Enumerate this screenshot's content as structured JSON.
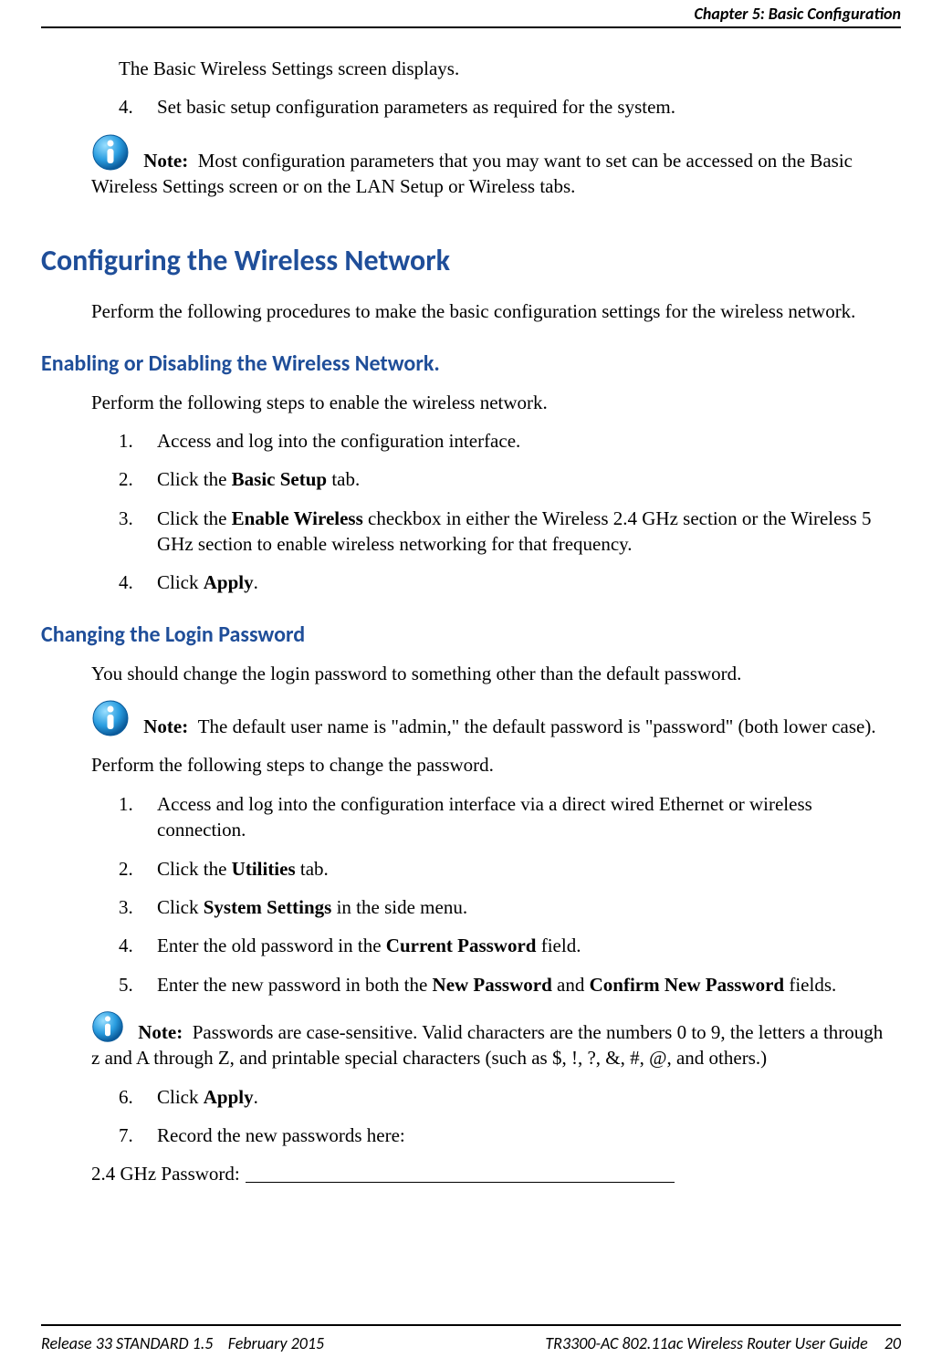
{
  "header": {
    "chapter": "Chapter 5",
    "separator": ":",
    "title": "Basic Configuration"
  },
  "intro": {
    "p1": "The Basic Wireless Settings screen displays.",
    "step4_num": "4.",
    "step4": "Set basic setup configuration parameters as required for the system.",
    "note_label": "Note:",
    "note_text": "Most configuration parameters that you may want to set can be accessed on the Basic Wireless Settings screen or on the LAN Setup or Wireless tabs."
  },
  "section1": {
    "heading": "Configuring the Wireless Network",
    "p1": "Perform the following procedures to make the basic configuration settings for the wireless network."
  },
  "enabling": {
    "heading": "Enabling or Disabling the Wireless Network.",
    "p1": "Perform the following steps to enable the wireless network.",
    "s1_num": "1.",
    "s1": "Access and log into the configuration interface.",
    "s2_num": "2.",
    "s2_a": "Click the ",
    "s2_b": "Basic Setup",
    "s2_c": " tab.",
    "s3_num": "3.",
    "s3_a": "Click the ",
    "s3_b": "Enable Wireless",
    "s3_c": " checkbox in either the Wireless 2.4 GHz section or the Wireless 5 GHz section to enable wireless networking for that frequency.",
    "s4_num": "4.",
    "s4_a": "Click ",
    "s4_b": "Apply",
    "s4_c": "."
  },
  "changing": {
    "heading": "Changing the Login Password",
    "p1": "You should change the login password to something other than the default password.",
    "note1_label": "Note:",
    "note1_text": "The default user name is \"admin,\" the default password is \"password\" (both lower case).",
    "p2": "Perform the following steps to change the password.",
    "s1_num": "1.",
    "s1": "Access and log into the configuration interface via a direct wired Ethernet or wireless connection.",
    "s2_num": "2.",
    "s2_a": "Click the ",
    "s2_b": "Utilities",
    "s2_c": " tab.",
    "s3_num": "3.",
    "s3_a": "Click ",
    "s3_b": "System Settings",
    "s3_c": " in the side menu.",
    "s4_num": "4.",
    "s4_a": "Enter the old password in the ",
    "s4_b": "Current Password",
    "s4_c": " field.",
    "s5_num": "5.",
    "s5_a": "Enter the new password in both the ",
    "s5_b": "New Password",
    "s5_c": " and ",
    "s5_d": "Confirm New Password",
    "s5_e": " fields.",
    "note2_label": "Note:",
    "note2_text": "Passwords are case-sensitive.  Valid characters are the numbers 0 to 9, the letters a through z and A through Z, and printable special characters (such as $, !, ?, &, #, @, and others.)",
    "s6_num": "6.",
    "s6_a": "Click ",
    "s6_b": "Apply",
    "s6_c": ".",
    "s7_num": "7.",
    "s7": "Record the new passwords here:",
    "fill_label": "2.4 GHz Password:"
  },
  "footer": {
    "left_a": "Release 33 STANDARD 1.5",
    "left_b": "February 2015",
    "right_title": "TR3300-AC 802.11ac Wireless Router User Guide",
    "page_num": "20"
  }
}
